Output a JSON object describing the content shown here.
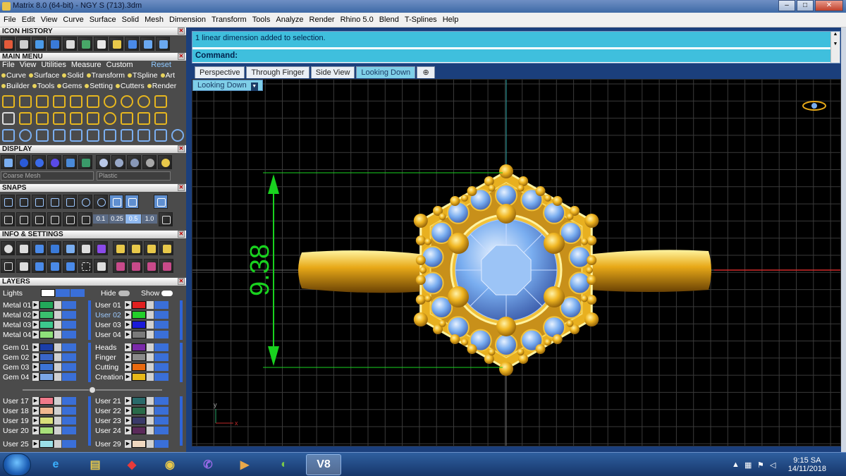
{
  "window": {
    "title": "Matrix 8.0 (64-bit) - NGY S (713).3dm",
    "min": "–",
    "max": "□",
    "close": "✕"
  },
  "menubar": [
    "File",
    "Edit",
    "View",
    "Curve",
    "Surface",
    "Solid",
    "Mesh",
    "Dimension",
    "Transform",
    "Tools",
    "Analyze",
    "Render",
    "Rhino 5.0",
    "Blend",
    "T-Splines",
    "Help"
  ],
  "panels": {
    "icon_history": "ICON HISTORY",
    "main_menu": "MAIN MENU",
    "display": "DISPLAY",
    "snaps": "SNAPS",
    "info_settings": "INFO & SETTINGS",
    "layers": "LAYERS",
    "close_glyph": "✕"
  },
  "main_menu": {
    "items": [
      "File",
      "View",
      "Utilities",
      "Measure",
      "Custom"
    ],
    "reset": "Reset",
    "row1": [
      "Curve",
      "Surface",
      "Solid",
      "Transform",
      "TSpline",
      "Art"
    ],
    "row2": [
      "Builder",
      "Tools",
      "Gems",
      "Setting",
      "Cutters",
      "Render"
    ]
  },
  "display": {
    "mesh_mode": "Coarse Mesh",
    "material": "Plastic"
  },
  "snaps": {
    "values": [
      "0.1",
      "0.25",
      "0.5",
      "1.0"
    ]
  },
  "layers": {
    "lights": "Lights",
    "hide": "Hide",
    "show": "Show",
    "left_a": [
      {
        "name": "Metal 01",
        "color": "#22a85a"
      },
      {
        "name": "Metal 02",
        "color": "#3ac06e"
      },
      {
        "name": "Metal 03",
        "color": "#3cc88e"
      },
      {
        "name": "Metal 04",
        "color": "#8fe07a"
      }
    ],
    "right_a": [
      {
        "name": "User 01",
        "color": "#e02020"
      },
      {
        "name": "User 02",
        "color": "#22d02a",
        "selected": true
      },
      {
        "name": "User 03",
        "color": "#1a1ad8"
      },
      {
        "name": "User 04",
        "color": "#7a7a7a"
      }
    ],
    "left_b": [
      {
        "name": "Gem 01",
        "color": "#1b3ea8"
      },
      {
        "name": "Gem 02",
        "color": "#3a66c8"
      },
      {
        "name": "Gem 03",
        "color": "#3c74d6"
      },
      {
        "name": "Gem 04",
        "color": "#7aa6e6"
      }
    ],
    "right_b": [
      {
        "name": "Heads",
        "color": "#7a2aa8"
      },
      {
        "name": "Finger",
        "color": "#8a8a8a"
      },
      {
        "name": "Cutting",
        "color": "#e86a10"
      },
      {
        "name": "Creation",
        "color": "#e8b818"
      }
    ],
    "left_c": [
      {
        "name": "User 17",
        "color": "#f07a8a"
      },
      {
        "name": "User 18",
        "color": "#f0b890"
      },
      {
        "name": "User 19",
        "color": "#d8e07a"
      },
      {
        "name": "User 20",
        "color": "#a8e07a"
      },
      {
        "name": "User 25",
        "color": "#9ae0e8"
      }
    ],
    "right_c": [
      {
        "name": "User 21",
        "color": "#2a6a6a"
      },
      {
        "name": "User 22",
        "color": "#2a6a4a"
      },
      {
        "name": "User 23",
        "color": "#3a3a6a"
      },
      {
        "name": "User 24",
        "color": "#5a2a5a"
      },
      {
        "name": "User 29",
        "color": "#f0d8c0"
      }
    ]
  },
  "command": {
    "history": "1 linear dimension added to selection.",
    "prompt": "Command:"
  },
  "viewport_tabs": [
    "Perspective",
    "Through Finger",
    "Side View",
    "Looking Down"
  ],
  "active_tab": "Looking Down",
  "add_tab": "⊕",
  "viewport": {
    "label": "Looking Down",
    "dimension": "9.38",
    "axis_y": "y",
    "axis_x": "x",
    "dimension_color": "#19d21f",
    "metal_color": "#e8a918",
    "gem_color": "#7aaef0"
  },
  "taskbar": {
    "time": "9:15 SA",
    "date": "14/11/2018",
    "apps": [
      "ie-icon",
      "explorer-icon",
      "game-icon",
      "chrome-icon",
      "viber-icon",
      "media-icon",
      "app-icon",
      "matrix-icon"
    ],
    "active_app": "V8"
  }
}
